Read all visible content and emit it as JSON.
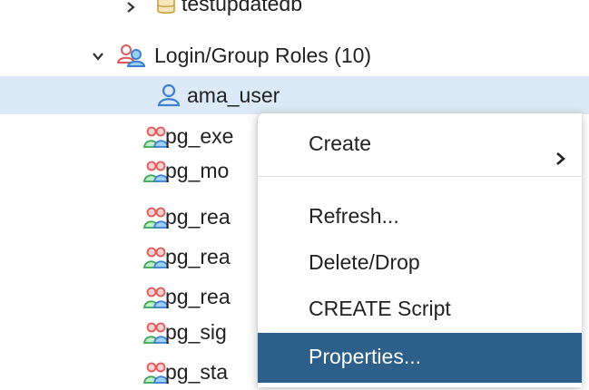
{
  "tree": {
    "db_item": {
      "label": "testupdatedb",
      "icon": "database-icon"
    },
    "group": {
      "label": "Login/Group Roles (10)",
      "icon": "login-group-roles-icon"
    },
    "selected": {
      "label": "ama_user",
      "icon": "user-role-icon"
    },
    "roles": [
      {
        "label": "pg_exe",
        "icon": "group-role-icon"
      },
      {
        "label": "pg_mo",
        "icon": "group-role-icon"
      },
      {
        "label": "pg_rea",
        "icon": "group-role-icon"
      },
      {
        "label": "pg_rea",
        "icon": "group-role-icon"
      },
      {
        "label": "pg_rea",
        "icon": "group-role-icon"
      },
      {
        "label": "pg_sig",
        "icon": "group-role-icon"
      },
      {
        "label": "pg_sta",
        "icon": "group-role-icon"
      }
    ]
  },
  "context_menu": {
    "create": "Create",
    "refresh": "Refresh...",
    "delete": "Delete/Drop",
    "create_script": "CREATE Script",
    "properties": "Properties..."
  },
  "colors": {
    "selected_row": "#dbeaf6",
    "menu_active": "#2c5f8a",
    "user_icon": "#3d7fd4",
    "role_red": "#e05a5a",
    "role_green": "#3aa55a"
  }
}
